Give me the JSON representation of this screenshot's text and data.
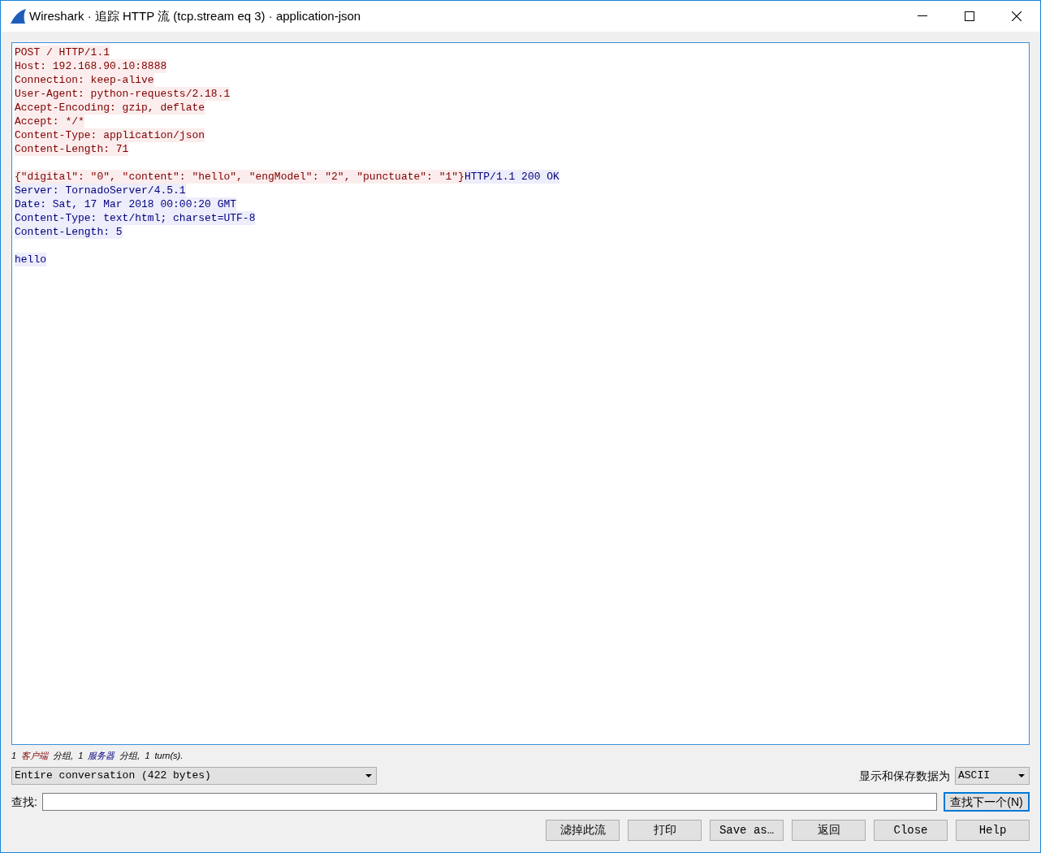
{
  "window": {
    "title": "Wireshark · 追踪 HTTP 流 (tcp.stream eq 3) · application-json"
  },
  "stream_lines": [
    {
      "kind": "text",
      "segments": [
        {
          "kind": "client",
          "text": "POST / HTTP/1.1"
        }
      ]
    },
    {
      "kind": "text",
      "segments": [
        {
          "kind": "client",
          "text": "Host: 192.168.90.10:8888"
        }
      ]
    },
    {
      "kind": "text",
      "segments": [
        {
          "kind": "client",
          "text": "Connection: keep-alive"
        }
      ]
    },
    {
      "kind": "text",
      "segments": [
        {
          "kind": "client",
          "text": "User-Agent: python-requests/2.18.1"
        }
      ]
    },
    {
      "kind": "text",
      "segments": [
        {
          "kind": "client",
          "text": "Accept-Encoding: gzip, deflate"
        }
      ]
    },
    {
      "kind": "text",
      "segments": [
        {
          "kind": "client",
          "text": "Accept: */*"
        }
      ]
    },
    {
      "kind": "text",
      "segments": [
        {
          "kind": "client",
          "text": "Content-Type: application/json"
        }
      ]
    },
    {
      "kind": "text",
      "segments": [
        {
          "kind": "client",
          "text": "Content-Length: 71"
        }
      ]
    },
    {
      "kind": "blank"
    },
    {
      "kind": "text",
      "segments": [
        {
          "kind": "client",
          "text": "{\"digital\": \"0\", \"content\": \"hello\", \"engModel\": \"2\", \"punctuate\": \"1\"}"
        },
        {
          "kind": "server",
          "text": "HTTP/1.1 200 OK"
        }
      ]
    },
    {
      "kind": "text",
      "segments": [
        {
          "kind": "server",
          "text": "Server: TornadoServer/4.5.1"
        }
      ]
    },
    {
      "kind": "text",
      "segments": [
        {
          "kind": "server",
          "text": "Date: Sat, 17 Mar 2018 00:00:20 GMT"
        }
      ]
    },
    {
      "kind": "text",
      "segments": [
        {
          "kind": "server",
          "text": "Content-Type: text/html; charset=UTF-8"
        }
      ]
    },
    {
      "kind": "text",
      "segments": [
        {
          "kind": "server",
          "text": "Content-Length: 5"
        }
      ]
    },
    {
      "kind": "blank"
    },
    {
      "kind": "text",
      "segments": [
        {
          "kind": "server",
          "text": "hello"
        }
      ]
    }
  ],
  "summary": [
    {
      "kind": "plain",
      "text": "1"
    },
    {
      "kind": "client",
      "text": "客户端"
    },
    {
      "kind": "plain",
      "text": "分组,"
    },
    {
      "kind": "plain",
      "text": "1"
    },
    {
      "kind": "server",
      "text": "服务器"
    },
    {
      "kind": "plain",
      "text": "分组,"
    },
    {
      "kind": "plain",
      "text": "1"
    },
    {
      "kind": "plain",
      "text": "turn(s)."
    }
  ],
  "conversation_select": {
    "value": "Entire conversation (422 bytes)"
  },
  "format_label": "显示和保存数据为",
  "format_select": {
    "value": "ASCII"
  },
  "find": {
    "label": "查找:",
    "button": "查找下一个(N)"
  },
  "buttons": [
    "滤掉此流",
    "打印",
    "Save as…",
    "返回",
    "Close",
    "Help"
  ]
}
